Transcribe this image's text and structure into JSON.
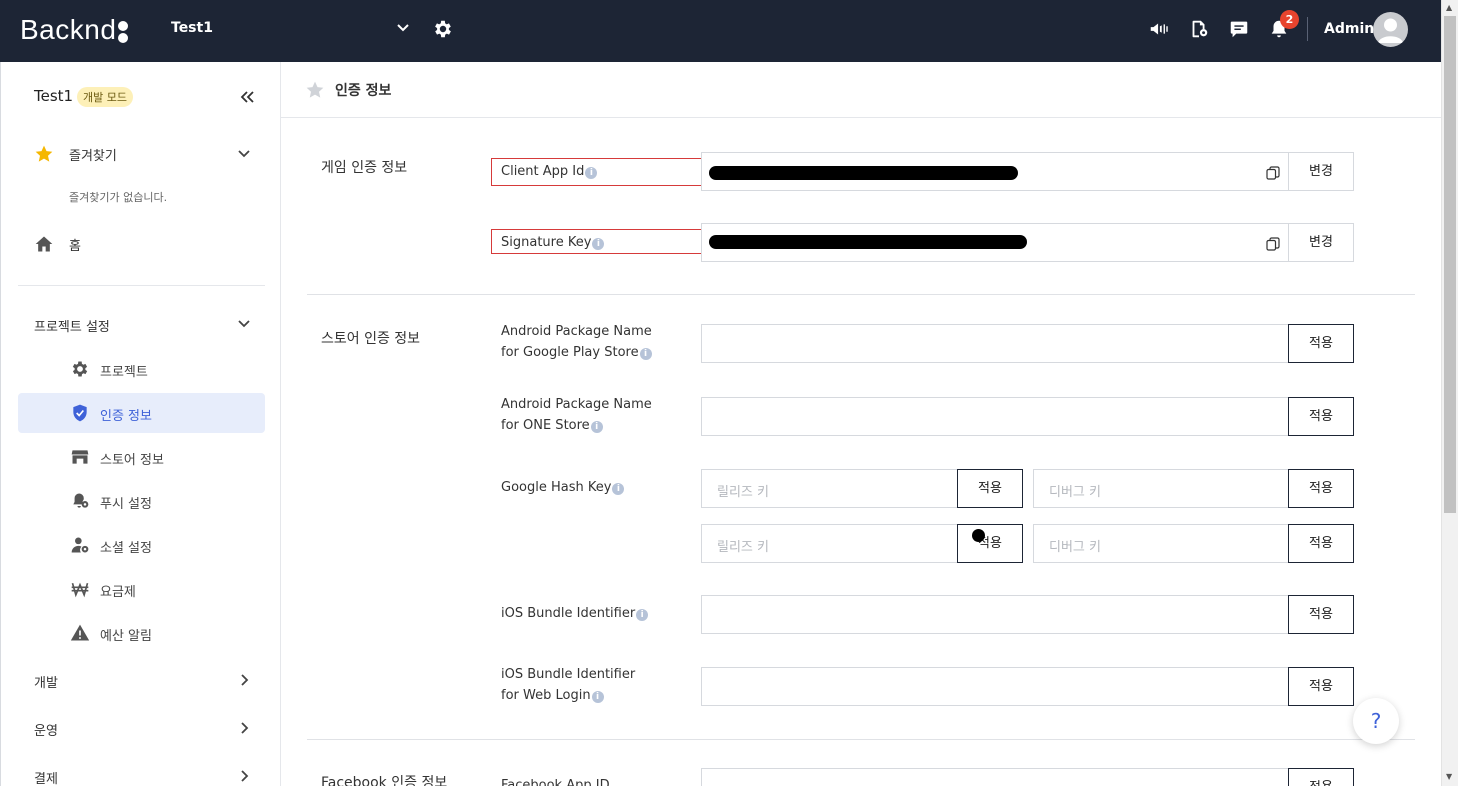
{
  "topbar": {
    "logo_text": "Backnd",
    "project_name": "Test1",
    "notification_count": "2",
    "user_name": "Admin"
  },
  "sidebar": {
    "project_name": "Test1",
    "mode_badge": "개발 모드",
    "favorites_label": "즐겨찾기",
    "favorites_empty": "즐겨찾기가 없습니다.",
    "home_label": "홈",
    "project_settings_label": "프로젝트 설정",
    "sub_items": [
      {
        "label": "프로젝트",
        "icon": "gear-icon"
      },
      {
        "label": "인증 정보",
        "icon": "shield-check-icon",
        "active": true
      },
      {
        "label": "스토어 정보",
        "icon": "store-icon"
      },
      {
        "label": "푸시 설정",
        "icon": "bell-gear-icon"
      },
      {
        "label": "소셜 설정",
        "icon": "user-gear-icon"
      },
      {
        "label": "요금제",
        "icon": "won-icon"
      },
      {
        "label": "예산 알림",
        "icon": "warning-icon"
      }
    ],
    "groups": [
      {
        "label": "개발"
      },
      {
        "label": "운영"
      },
      {
        "label": "결제"
      }
    ]
  },
  "main": {
    "title": "인증 정보",
    "game_auth": {
      "section_title": "게임 인증 정보",
      "client_app_id_label": "Client App Id",
      "signature_key_label": "Signature Key",
      "change_label": "변경"
    },
    "store_auth": {
      "section_title": "스토어 인증 정보",
      "android_google_label_1": "Android Package Name",
      "android_google_label_2": "for Google Play Store",
      "android_one_label_1": "Android Package Name",
      "android_one_label_2": "for ONE Store",
      "google_hash_label": "Google Hash Key",
      "release_key_placeholder": "릴리즈 키",
      "debug_key_placeholder": "디버그 키",
      "ios_bundle_label": "iOS Bundle Identifier",
      "ios_web_label_1": "iOS Bundle Identifier",
      "ios_web_label_2": "for Web Login",
      "apply_label": "적용"
    },
    "facebook": {
      "section_title": "Facebook 인증 정보",
      "app_id_label": "Facebook App ID"
    }
  },
  "colors": {
    "topbar_bg": "#1d2535",
    "accent": "#3f62d8",
    "highlight_red": "#d63a3a",
    "star_yellow": "#f5b700"
  }
}
